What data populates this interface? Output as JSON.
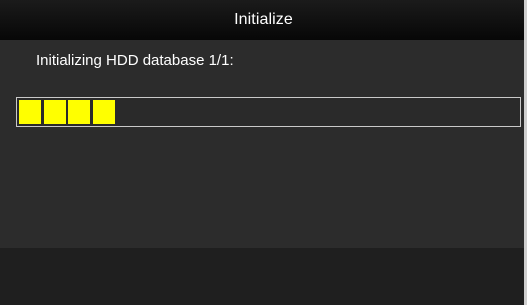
{
  "dialog": {
    "title": "Initialize",
    "status": "Initializing HDD database 1/1:",
    "progress": {
      "filled_segments": 4,
      "fill_color": "#ffff00",
      "fraction": 0.2
    }
  }
}
